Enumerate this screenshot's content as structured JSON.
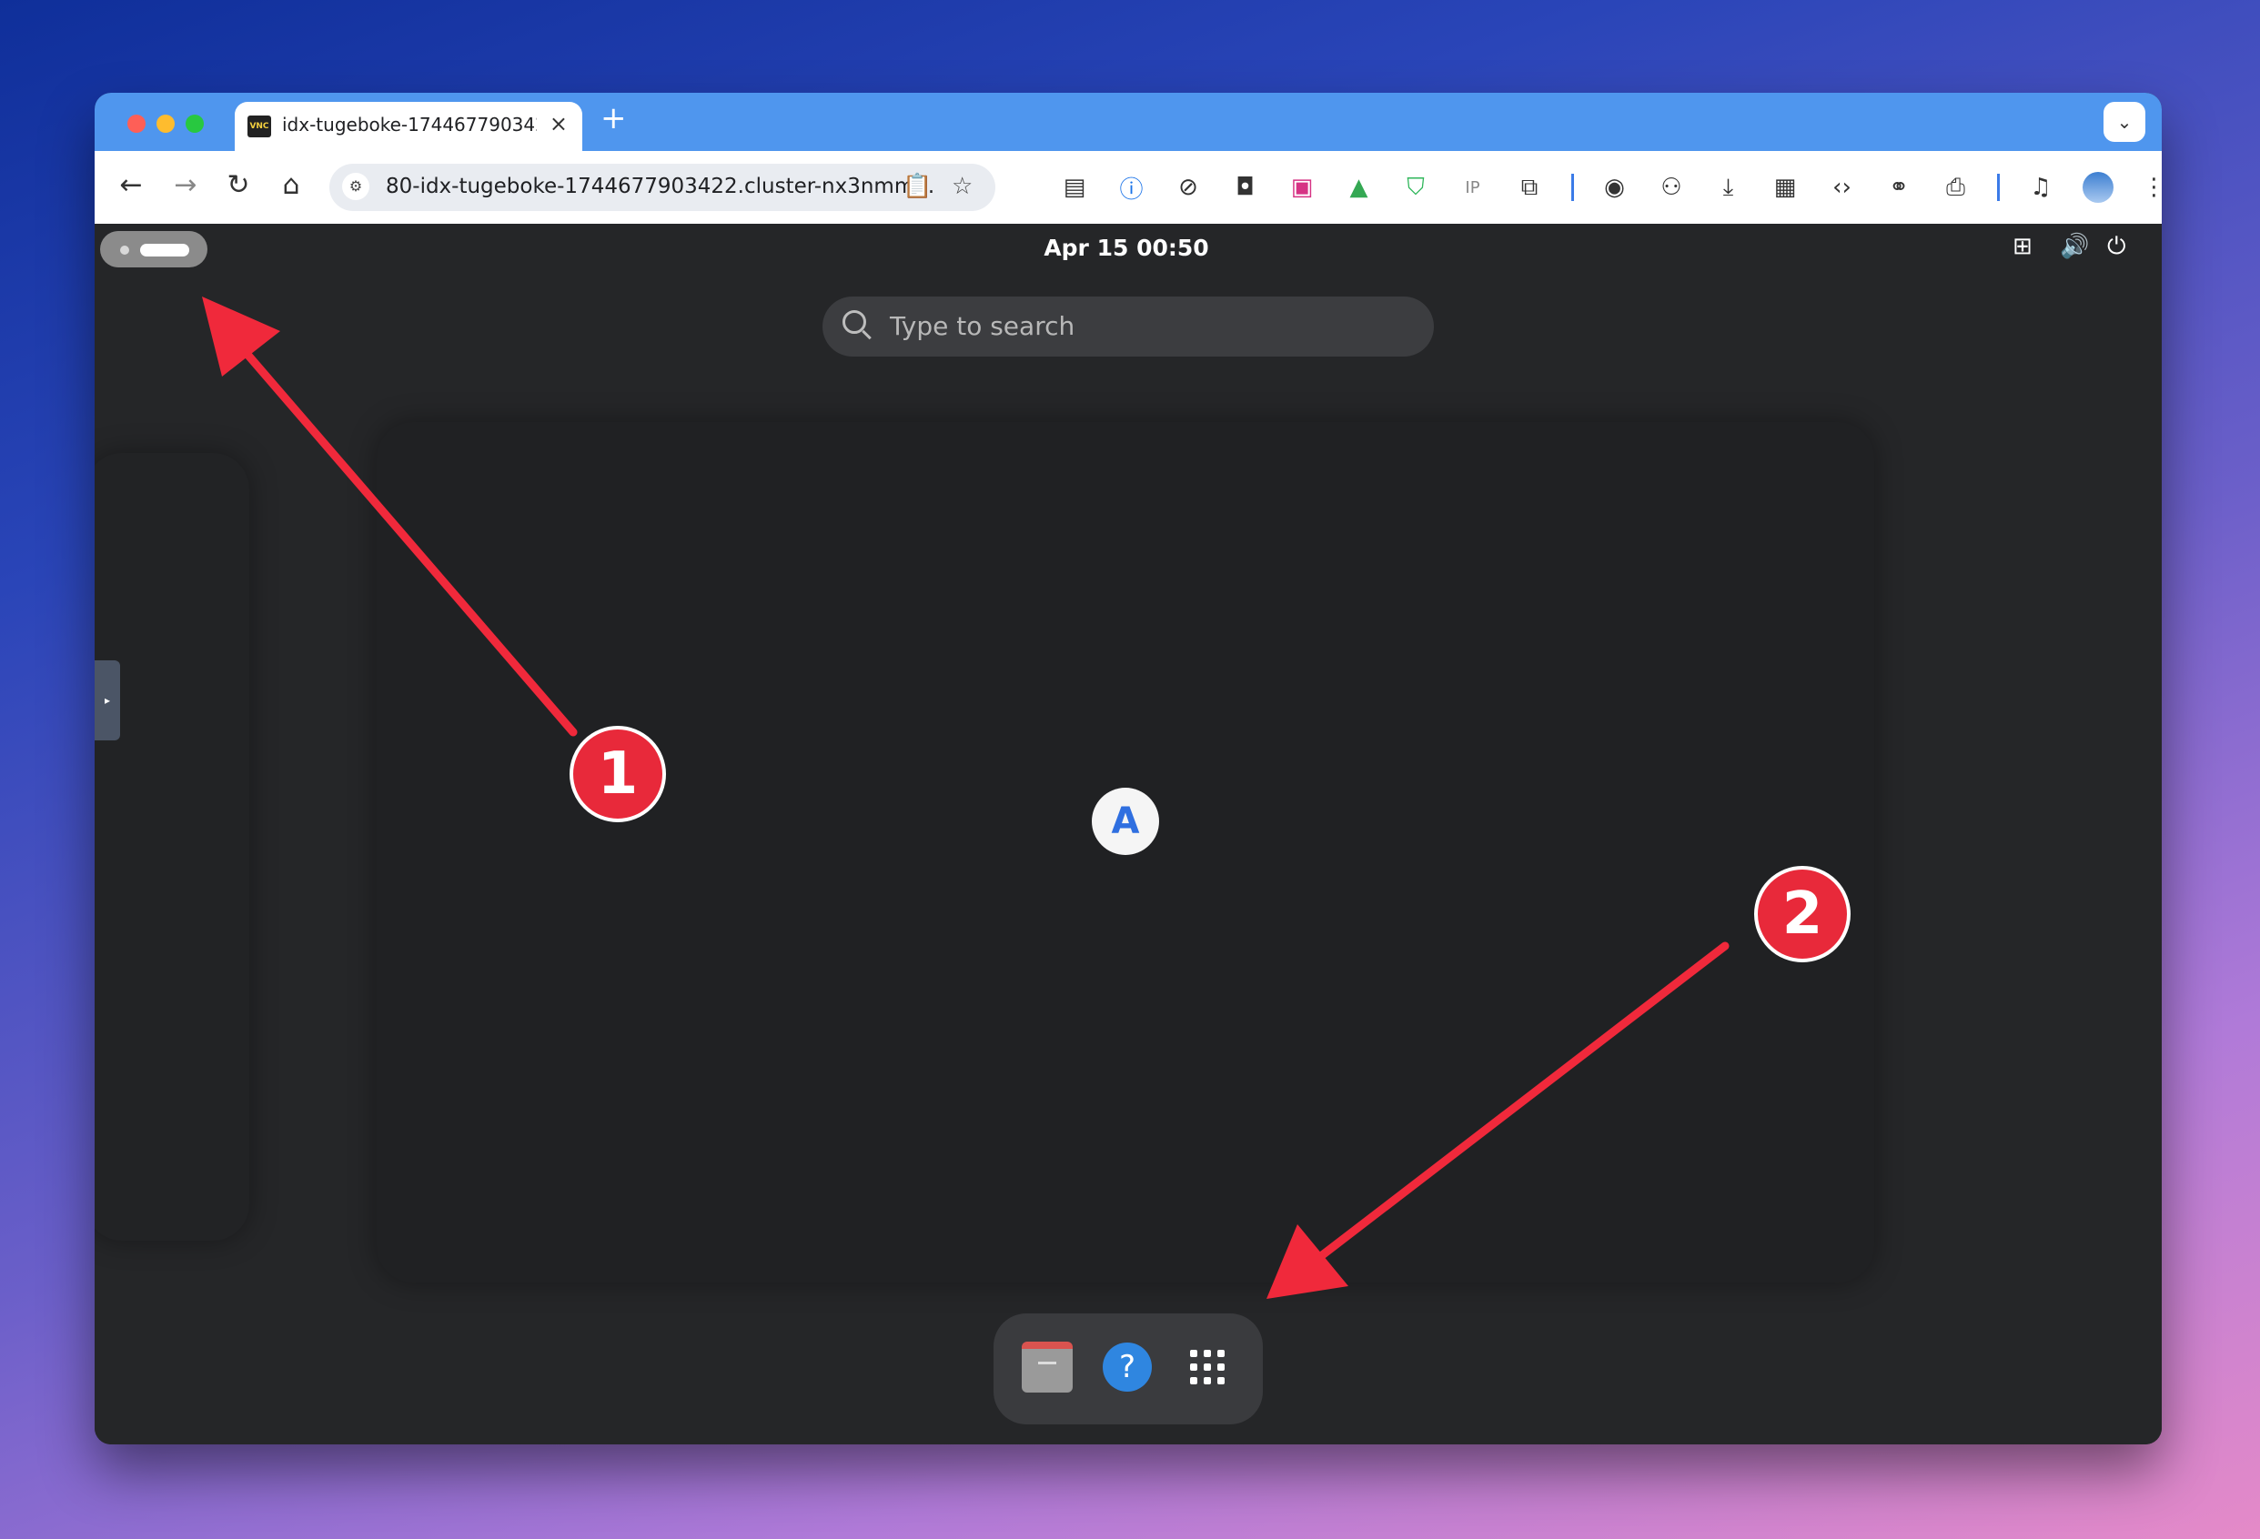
{
  "browser": {
    "tab": {
      "favicon_text": "VNC",
      "title": "idx-tugeboke-1744677903422",
      "close_glyph": "×"
    },
    "new_tab_glyph": "+",
    "tab_menu_glyph": "⌄",
    "nav": {
      "back": "←",
      "forward": "→",
      "reload": "↻",
      "home": "⌂"
    },
    "omnibox": {
      "url": "80-idx-tugeboke-1744677903422.cluster-nx3nmm..."
    },
    "extensions": [
      "reader-icon",
      "onepassword-icon",
      "block-icon",
      "dual-icon",
      "screenshot-icon",
      "drive-icon",
      "shield-icon",
      "ip-icon",
      "puzzle-icon",
      "camera-icon",
      "incognito-icon",
      "download-icon",
      "qr-icon",
      "code-icon",
      "link-icon",
      "print-icon",
      "media-icon",
      "avatar-icon",
      "menu-icon"
    ]
  },
  "desktop": {
    "clock": "Apr 15  00:50",
    "search_placeholder": "Type to search",
    "app_icon_letter": "A",
    "help_glyph": "?",
    "vnc_handle_glyph": "▸"
  },
  "annotations": {
    "badge_1": "1",
    "badge_2": "2",
    "arrow_color": "#f0293b"
  },
  "colors": {
    "tabbar": "#4f96ee",
    "desktop_bg": "#252628",
    "dock_bg": "#3a3b3e"
  }
}
